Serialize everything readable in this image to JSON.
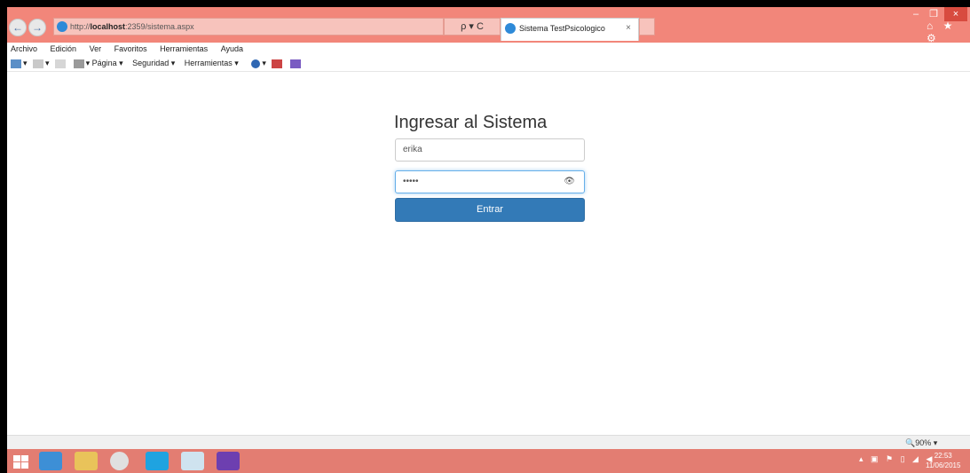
{
  "browser": {
    "url_scheme": "http://",
    "url_host": "localhost",
    "url_rest": ":2359/sistema.aspx",
    "search_label": "ρ ▾ C",
    "tab_title": "Sistema TestPsicologico",
    "tab_close": "×",
    "window_controls": {
      "minimize": "–",
      "restore": "❐",
      "close": "×"
    },
    "toolbar_icons": "⌂ ★ ⚙"
  },
  "menu": {
    "items": [
      "Archivo",
      "Edición",
      "Ver",
      "Favoritos",
      "Herramientas",
      "Ayuda"
    ]
  },
  "command_bar": {
    "items": [
      "Página ▾",
      "Seguridad ▾",
      "Herramientas ▾"
    ]
  },
  "login": {
    "title": "Ingresar al Sistema",
    "username_value": "erika",
    "password_value": "•••••",
    "reveal_icon": "👁",
    "submit_label": "Entrar"
  },
  "statusbar": {
    "zoom": "🔍90%  ▾"
  },
  "taskbar": {
    "clock_time": "22:53",
    "clock_date": "11/06/2015"
  },
  "colors": {
    "titlebar": "#f2867a",
    "button_primary": "#337ab7",
    "taskbar": "#e37d72"
  }
}
